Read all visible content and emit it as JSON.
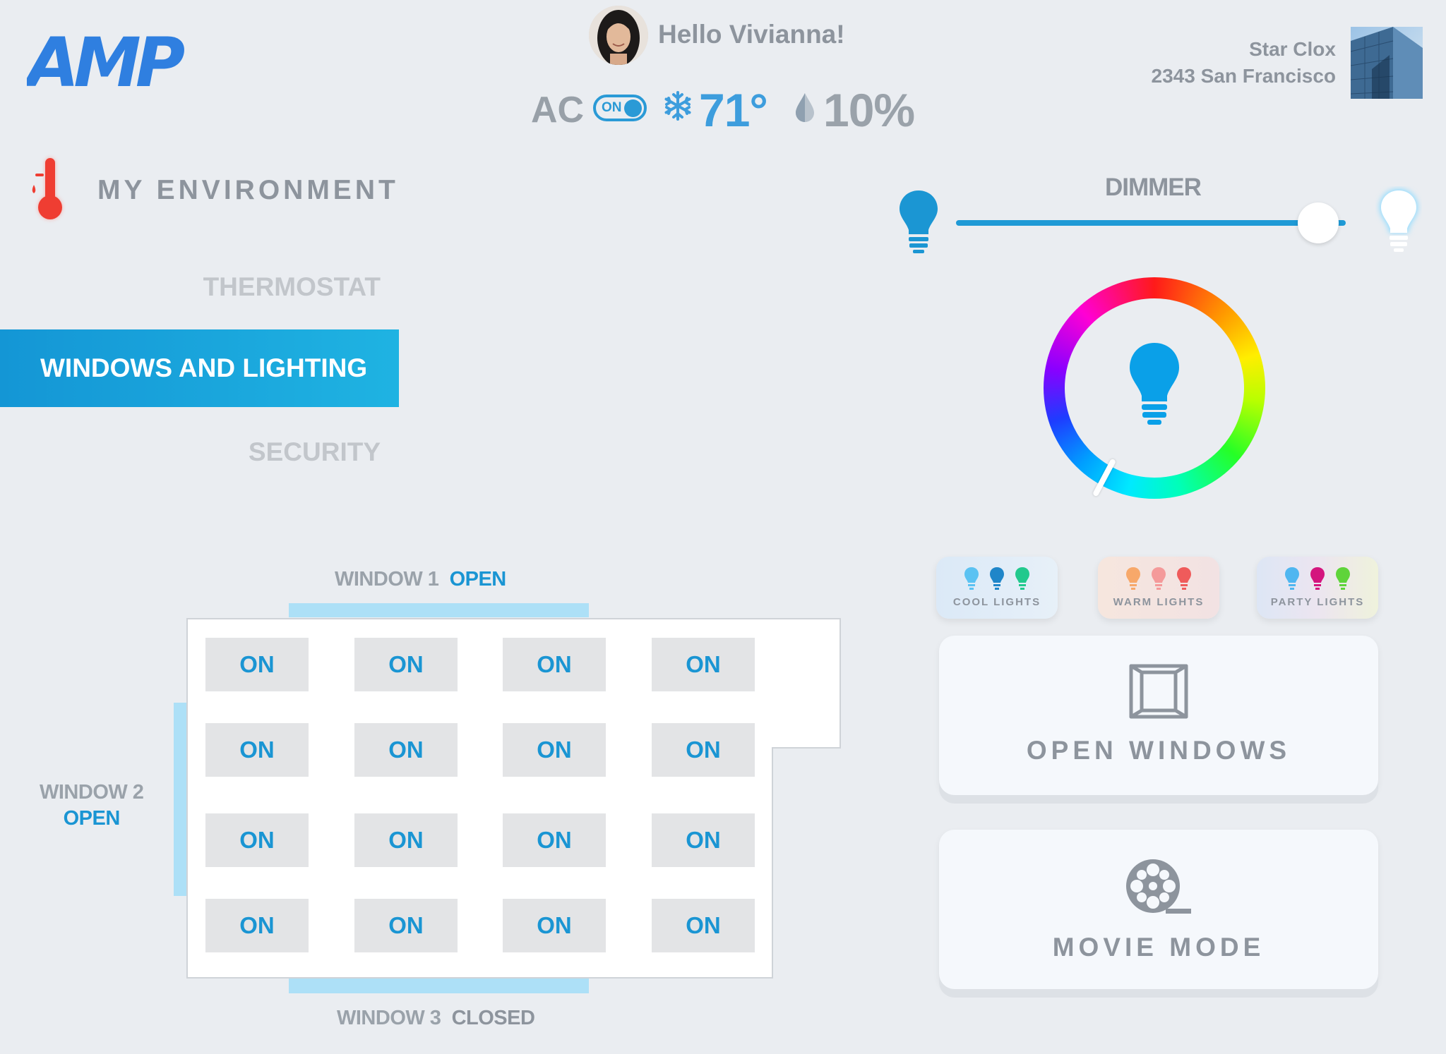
{
  "header": {
    "logo_text": "AMP",
    "greeting": "Hello Vivianna!",
    "ac_label": "AC",
    "ac_toggle_state": "ON",
    "temperature": "71°",
    "humidity": "10%",
    "location_name": "Star Clox",
    "location_address": "2343 San Francisco"
  },
  "sidebar": {
    "section_title": "MY ENVIRONMENT",
    "items": [
      {
        "label": "THERMOSTAT",
        "active": false
      },
      {
        "label": "WINDOWS AND LIGHTING",
        "active": true
      },
      {
        "label": "SECURITY",
        "active": false
      }
    ]
  },
  "floorplan": {
    "windows": [
      {
        "name": "WINDOW 1",
        "status": "OPEN"
      },
      {
        "name": "WINDOW 2",
        "status": "OPEN"
      },
      {
        "name": "WINDOW 3",
        "status": "CLOSED"
      }
    ],
    "grid": [
      [
        "ON",
        "ON",
        "ON",
        "ON"
      ],
      [
        "ON",
        "ON",
        "ON",
        "ON"
      ],
      [
        "ON",
        "ON",
        "ON",
        "ON"
      ],
      [
        "ON",
        "ON",
        "ON",
        "ON"
      ]
    ]
  },
  "lighting": {
    "dimmer_label": "DIMMER",
    "dimmer_level": 0.93,
    "presets": [
      {
        "label": "COOL LIGHTS",
        "colors": [
          "#5bc2f2",
          "#1f86c9",
          "#22c98d"
        ]
      },
      {
        "label": "WARM LIGHTS",
        "colors": [
          "#f7a86a",
          "#f49a9a",
          "#ef5b5b"
        ]
      },
      {
        "label": "PARTY LIGHTS",
        "colors": [
          "#4fb6f0",
          "#d4157e",
          "#5fd43a"
        ]
      }
    ],
    "actions": [
      {
        "label": "OPEN WINDOWS",
        "icon": "window-icon"
      },
      {
        "label": "MOVIE MODE",
        "icon": "film-reel-icon"
      }
    ],
    "accent": "#1a95d3"
  }
}
